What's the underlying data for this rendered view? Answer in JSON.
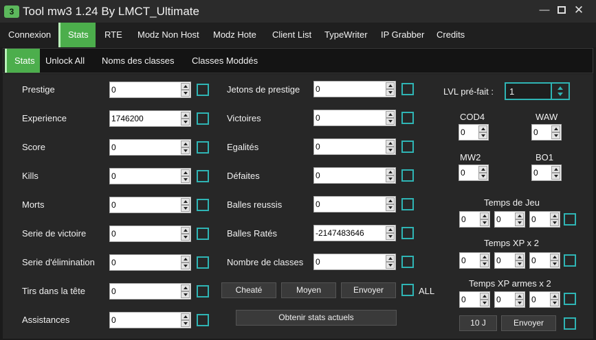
{
  "window": {
    "icon_text": "3",
    "title": "Tool mw3 1.24 By LMCT_Ultimate",
    "min": "—",
    "close": "✕"
  },
  "topnav": [
    "Connexion",
    "Stats",
    "RTE",
    "Modz Non Host",
    "Modz Hote",
    "Client List",
    "TypeWriter",
    "IP Grabber",
    "Credits"
  ],
  "subnav": [
    "Stats",
    "Unlock All",
    "Noms des classes",
    "Classes Moddés"
  ],
  "left_fields": [
    {
      "label": "Prestige",
      "value": "0"
    },
    {
      "label": "Experience",
      "value": "1746200"
    },
    {
      "label": "Score",
      "value": "0"
    },
    {
      "label": "Kills",
      "value": "0"
    },
    {
      "label": "Morts",
      "value": "0"
    },
    {
      "label": "Serie de victoire",
      "value": "0"
    },
    {
      "label": "Serie d'élimination",
      "value": "0"
    },
    {
      "label": "Tirs dans la tête",
      "value": "0"
    },
    {
      "label": "Assistances",
      "value": "0"
    }
  ],
  "mid_fields": [
    {
      "label": "Jetons de prestige",
      "value": "0"
    },
    {
      "label": "Victoires",
      "value": "0"
    },
    {
      "label": "Egalités",
      "value": "0"
    },
    {
      "label": "Défaites",
      "value": "0"
    },
    {
      "label": "Balles reussis",
      "value": "0"
    },
    {
      "label": "Balles Ratés",
      "value": "-2147483646"
    },
    {
      "label": "Nombre de classes",
      "value": "0"
    }
  ],
  "mid_buttons": {
    "cheate": "Cheaté",
    "moyen": "Moyen",
    "envoyer": "Envoyer",
    "all_label": "ALL",
    "obtenir": "Obtenir stats actuels"
  },
  "right": {
    "lvl_label": "LVL pré-fait :",
    "lvl_value": "1",
    "games": [
      {
        "label": "COD4",
        "value": "0"
      },
      {
        "label": "WAW",
        "value": "0"
      },
      {
        "label": "MW2",
        "value": "0"
      },
      {
        "label": "BO1",
        "value": "0"
      }
    ],
    "temps_de_jeu": {
      "label": "Temps de Jeu",
      "values": [
        "0",
        "0",
        "0"
      ]
    },
    "temps_xp": {
      "label": "Temps XP x 2",
      "values": [
        "0",
        "0",
        "0"
      ]
    },
    "temps_xp_armes": {
      "label": "Temps XP armes x 2",
      "values": [
        "0",
        "0",
        "0"
      ]
    },
    "btn_10j": "10 J",
    "btn_envoyer": "Envoyer"
  },
  "colors": {
    "accent_green": "#4cae4c",
    "checkbox_teal": "#2fb5b5",
    "background": "#272727"
  }
}
